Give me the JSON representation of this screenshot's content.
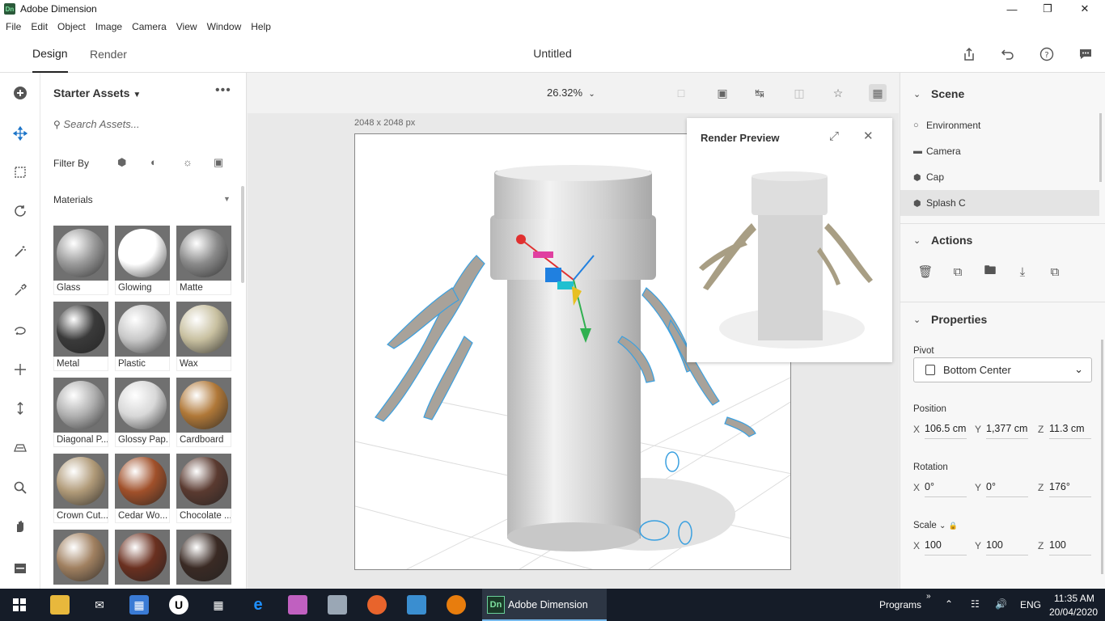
{
  "window": {
    "title": "Adobe Dimension",
    "app_badge": "Dn"
  },
  "menu": [
    "File",
    "Edit",
    "Object",
    "Image",
    "Camera",
    "View",
    "Window",
    "Help"
  ],
  "tabs": {
    "design": "Design",
    "render": "Render"
  },
  "document_title": "Untitled",
  "assets": {
    "title": "Starter Assets",
    "search_placeholder": "Search Assets...",
    "filter_label": "Filter By",
    "materials_label": "Materials",
    "items": [
      {
        "label": "Glass",
        "color": "#9a9a9a"
      },
      {
        "label": "Glowing",
        "color": "#ffffff"
      },
      {
        "label": "Matte",
        "color": "#8a8a8a"
      },
      {
        "label": "Metal",
        "color": "#3a3a3a"
      },
      {
        "label": "Plastic",
        "color": "#c8c8c8"
      },
      {
        "label": "Wax",
        "color": "#c8c0a0"
      },
      {
        "label": "Diagonal P...",
        "color": "#b0b0b0"
      },
      {
        "label": "Glossy Pap...",
        "color": "#d8d8d8"
      },
      {
        "label": "Cardboard",
        "color": "#b07838"
      },
      {
        "label": "Crown Cut...",
        "color": "#b09a78"
      },
      {
        "label": "Cedar Wo...",
        "color": "#a0502a"
      },
      {
        "label": "Chocolate ...",
        "color": "#5a3a30"
      },
      {
        "label": "",
        "color": "#a08060"
      },
      {
        "label": "",
        "color": "#6a3020"
      },
      {
        "label": "",
        "color": "#3a2a24"
      }
    ]
  },
  "canvas": {
    "zoom": "26.32%",
    "doc_size": "2048 x 2048 px",
    "render_preview_title": "Render Preview"
  },
  "scene": {
    "title": "Scene",
    "items": [
      "Environment",
      "Camera",
      "Cap",
      "Splash C"
    ],
    "selected": "Splash C"
  },
  "actions": {
    "title": "Actions"
  },
  "properties": {
    "title": "Properties",
    "pivot_label": "Pivot",
    "pivot_value": "Bottom Center",
    "position_label": "Position",
    "position": {
      "x": "106.5 cm",
      "y": "1,377 cm",
      "z": "11.3 cm"
    },
    "rotation_label": "Rotation",
    "rotation": {
      "x": "0°",
      "y": "0°",
      "z": "176°"
    },
    "scale_label": "Scale",
    "scale": {
      "x": "100",
      "y": "100",
      "z": "100"
    }
  },
  "taskbar": {
    "active_app": "Adobe Dimension",
    "programs": "Programs",
    "lang": "ENG",
    "time": "11:35 AM",
    "date": "20/04/2020"
  }
}
